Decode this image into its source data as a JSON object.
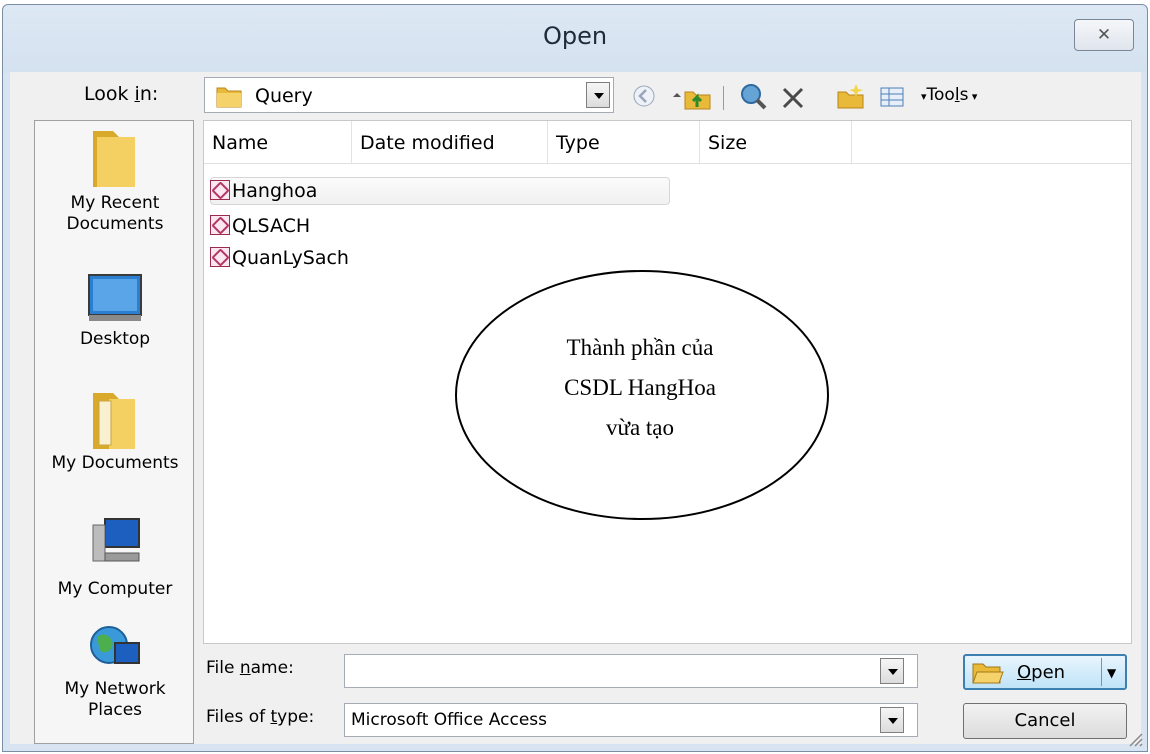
{
  "window": {
    "title": "Open"
  },
  "toolbar": {
    "look_in_label_pre": "Look ",
    "look_in_label_key": "i",
    "look_in_label_post": "n:",
    "look_in_value": "Query",
    "tools_pre": "Too",
    "tools_key": "l",
    "tools_post": "s"
  },
  "places": [
    {
      "label_line1": "My Recent",
      "label_line2": "Documents"
    },
    {
      "label_line1": "Desktop"
    },
    {
      "label_line1": "My Documents"
    },
    {
      "label_line1": "My Computer"
    },
    {
      "label_line1": "My Network",
      "label_line2": "Places"
    }
  ],
  "columns": [
    "Name",
    "Date modified",
    "Type",
    "Size"
  ],
  "files": [
    "Hanghoa",
    "QLSACH",
    "QuanLySach"
  ],
  "bottom": {
    "file_name_pre": "File ",
    "file_name_key": "n",
    "file_name_post": "ame:",
    "file_name_value": "",
    "file_type_pre": "Files of ",
    "file_type_key": "t",
    "file_type_post": "ype:",
    "file_type_value": "Microsoft Office Access",
    "open_key": "O",
    "open_post": "pen",
    "cancel": "Cancel"
  },
  "annotation": {
    "line1": "Thành phần của",
    "line2": "CSDL HangHoa",
    "line3": "vừa tạo"
  }
}
